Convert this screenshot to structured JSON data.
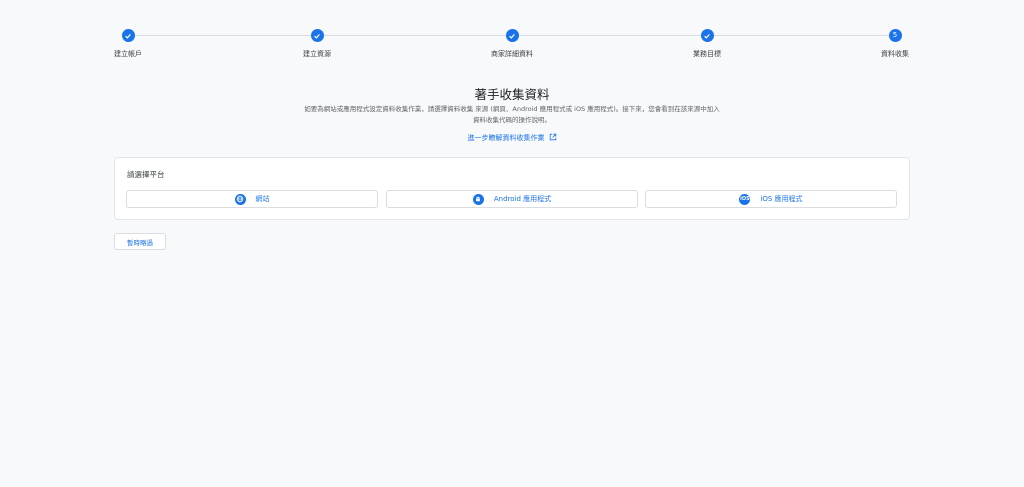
{
  "stepper": {
    "steps": [
      {
        "label": "建立帳戶",
        "status": "done"
      },
      {
        "label": "建立資源",
        "status": "done"
      },
      {
        "label": "商家詳細資料",
        "status": "done"
      },
      {
        "label": "業務目標",
        "status": "done"
      },
      {
        "label": "資料收集",
        "status": "current",
        "number": "5"
      }
    ]
  },
  "main": {
    "title": "著手收集資料",
    "description": "如要為網站或應用程式設定資料收集作業，請選擇資料收集 來源 (網頁、Android 應用程式或 iOS 應用程式)。接下來，您會看到在該來源中加入 資料收集代碼的操作說明。",
    "learn_more": "進一步瞭解資料收集作業"
  },
  "platform_card": {
    "title": "請選擇平台",
    "buttons": [
      {
        "label": "網站",
        "icon": "globe-icon"
      },
      {
        "label": "Android 應用程式",
        "icon": "android-icon"
      },
      {
        "label": "iOS 應用程式",
        "icon": "ios-icon",
        "icon_text": "iOS"
      }
    ]
  },
  "actions": {
    "skip_label": "暫時略過"
  },
  "colors": {
    "accent": "#1a73e8",
    "background": "#f8f9fb"
  }
}
